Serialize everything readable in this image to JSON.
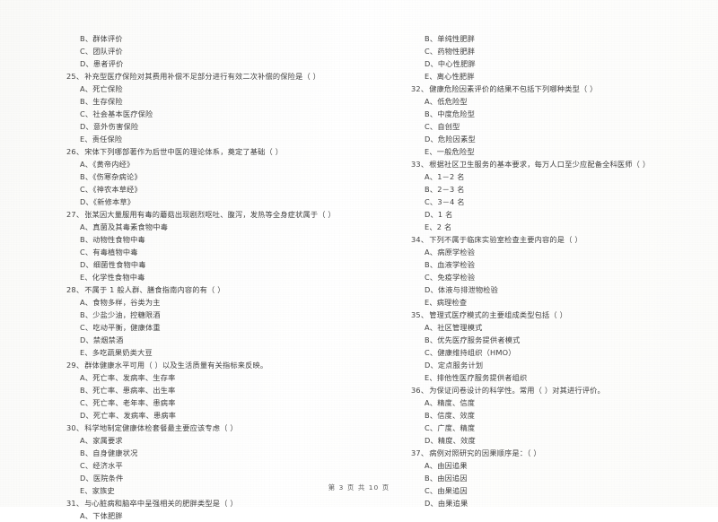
{
  "document": {
    "type": "exam-paper",
    "footer": "第 3 页  共 10 页"
  },
  "left_column": [
    {
      "kind": "option",
      "letter": "B、",
      "text": "群体评价"
    },
    {
      "kind": "option",
      "letter": "C、",
      "text": "团队评价"
    },
    {
      "kind": "option",
      "letter": "D、",
      "text": "患者评价"
    },
    {
      "kind": "question",
      "number": "25、",
      "text": "补充型医疗保险对其费用补偿不足部分进行有效二次补偿的保险是（        ）"
    },
    {
      "kind": "option",
      "letter": "A、",
      "text": "死亡保险"
    },
    {
      "kind": "option",
      "letter": "B、",
      "text": "生存保险"
    },
    {
      "kind": "option",
      "letter": "C、",
      "text": "社会基本医疗保险"
    },
    {
      "kind": "option",
      "letter": "D、",
      "text": "意外伤害保险"
    },
    {
      "kind": "option",
      "letter": "E、",
      "text": "责任保险"
    },
    {
      "kind": "question",
      "number": "26、",
      "text": "宋体下列哪部著作为后世中医的理论体系，奠定了基础（        ）"
    },
    {
      "kind": "option",
      "letter": "A、",
      "text": "《黄帝内经》"
    },
    {
      "kind": "option",
      "letter": "B、",
      "text": "《伤寒杂病论》"
    },
    {
      "kind": "option",
      "letter": "C、",
      "text": "《神农本草经》"
    },
    {
      "kind": "option",
      "letter": "D、",
      "text": "《新修本草》"
    },
    {
      "kind": "question",
      "number": "27、",
      "text": "张某因大量服用有毒的蘑菇出现剧烈呕吐、腹泻，发热等全身症状属于（        ）"
    },
    {
      "kind": "option",
      "letter": "A、",
      "text": "真菌及其毒素食物中毒"
    },
    {
      "kind": "option",
      "letter": "B、",
      "text": "动物性食物中毒"
    },
    {
      "kind": "option",
      "letter": "C、",
      "text": "有毒植物中毒"
    },
    {
      "kind": "option",
      "letter": "D、",
      "text": "细菌性食物中毒"
    },
    {
      "kind": "option",
      "letter": "E、",
      "text": "化学性食物中毒"
    },
    {
      "kind": "question",
      "number": "28、",
      "text": "不属于 1 般人群、膳食指南内容的有（        ）"
    },
    {
      "kind": "option",
      "letter": "A、",
      "text": "食物多样，谷类为主"
    },
    {
      "kind": "option",
      "letter": "B、",
      "text": "少盐少油，控糖限酒"
    },
    {
      "kind": "option",
      "letter": "C、",
      "text": "吃动平衡，健康体重"
    },
    {
      "kind": "option",
      "letter": "D、",
      "text": "禁烟禁酒"
    },
    {
      "kind": "option",
      "letter": "E、",
      "text": "多吃蔬果奶类大豆"
    },
    {
      "kind": "question",
      "number": "29、",
      "text": "群体健康水平可用（        ）以及生活质量有关指标来反映。"
    },
    {
      "kind": "option",
      "letter": "A、",
      "text": "死亡率、发病率、生存率"
    },
    {
      "kind": "option",
      "letter": "B、",
      "text": "死亡率、患病率、出生率"
    },
    {
      "kind": "option",
      "letter": "C、",
      "text": "死亡率、老年率、患病率"
    },
    {
      "kind": "option",
      "letter": "D、",
      "text": "死亡率、发病率、患病率"
    },
    {
      "kind": "question",
      "number": "30、",
      "text": "科学地制定健康体检套餐最主要应该专虑（        ）"
    },
    {
      "kind": "option",
      "letter": "A、",
      "text": "家属要求"
    },
    {
      "kind": "option",
      "letter": "B、",
      "text": "自身健康状况"
    },
    {
      "kind": "option",
      "letter": "C、",
      "text": "经济水平"
    },
    {
      "kind": "option",
      "letter": "D、",
      "text": "医院条件"
    },
    {
      "kind": "option",
      "letter": "E、",
      "text": "家族史"
    },
    {
      "kind": "question",
      "number": "31、",
      "text": "与心脏病和脑卒中呈强相关的肥胖类型是（        ）"
    },
    {
      "kind": "option",
      "letter": "A、",
      "text": "下体肥胖"
    }
  ],
  "right_column": [
    {
      "kind": "option",
      "letter": "B、",
      "text": "单纯性肥胖"
    },
    {
      "kind": "option",
      "letter": "C、",
      "text": "药物性肥胖"
    },
    {
      "kind": "option",
      "letter": "D、",
      "text": "中心性肥胖"
    },
    {
      "kind": "option",
      "letter": "E、",
      "text": "离心性肥胖"
    },
    {
      "kind": "question",
      "number": "32、",
      "text": "健康危险因素评价的结果不包括下列哪种类型（        ）"
    },
    {
      "kind": "option",
      "letter": "A、",
      "text": "低危险型"
    },
    {
      "kind": "option",
      "letter": "B、",
      "text": "中度危险型"
    },
    {
      "kind": "option",
      "letter": "C、",
      "text": "自创型"
    },
    {
      "kind": "option",
      "letter": "D、",
      "text": "危险因素型"
    },
    {
      "kind": "option",
      "letter": "E、",
      "text": "一般危险型"
    },
    {
      "kind": "question",
      "number": "33、",
      "text": "根据社区卫生服务的基本要求，每万人口至少应配备全科医师（        ）"
    },
    {
      "kind": "option",
      "letter": "A、",
      "text": "1－2 名"
    },
    {
      "kind": "option",
      "letter": "B、",
      "text": "2－3 名"
    },
    {
      "kind": "option",
      "letter": "C、",
      "text": "3－4 名"
    },
    {
      "kind": "option",
      "letter": "D、",
      "text": "1 名"
    },
    {
      "kind": "option",
      "letter": "E、",
      "text": "2 名"
    },
    {
      "kind": "question",
      "number": "34、",
      "text": "下列不属于临床实验室检查主要内容的是（        ）"
    },
    {
      "kind": "option",
      "letter": "A、",
      "text": "病原学检验"
    },
    {
      "kind": "option",
      "letter": "B、",
      "text": "血液学检验"
    },
    {
      "kind": "option",
      "letter": "C、",
      "text": "免疫学检验"
    },
    {
      "kind": "option",
      "letter": "D、",
      "text": "体液与排泄物检验"
    },
    {
      "kind": "option",
      "letter": "E、",
      "text": "病理检查"
    },
    {
      "kind": "question",
      "number": "35、",
      "text": "管理式医疗模式的主要组成类型包括（        ）"
    },
    {
      "kind": "option",
      "letter": "A、",
      "text": "社区管理模式"
    },
    {
      "kind": "option",
      "letter": "B、",
      "text": "优先医疗服务提供者模式"
    },
    {
      "kind": "option",
      "letter": "C、",
      "text": "健康维持组织（HMO）"
    },
    {
      "kind": "option",
      "letter": "D、",
      "text": "定点服务计划"
    },
    {
      "kind": "option",
      "letter": "E、",
      "text": "排他性医疗服务提供者组织"
    },
    {
      "kind": "question",
      "number": "36、",
      "text": "为保证问卷设计的科学性。常用（        ）对其进行评价。"
    },
    {
      "kind": "option",
      "letter": "A、",
      "text": "精度、信度"
    },
    {
      "kind": "option",
      "letter": "B、",
      "text": "信度、效度"
    },
    {
      "kind": "option",
      "letter": "C、",
      "text": "广度、精度"
    },
    {
      "kind": "option",
      "letter": "D、",
      "text": "精度、效度"
    },
    {
      "kind": "question",
      "number": "37、",
      "text": "病例对照研究的因果顺序是：（        ）"
    },
    {
      "kind": "option",
      "letter": "A、",
      "text": "由因追果"
    },
    {
      "kind": "option",
      "letter": "B、",
      "text": "由因追因"
    },
    {
      "kind": "option",
      "letter": "C、",
      "text": "由果追因"
    },
    {
      "kind": "option",
      "letter": "D、",
      "text": "由果追果"
    }
  ]
}
